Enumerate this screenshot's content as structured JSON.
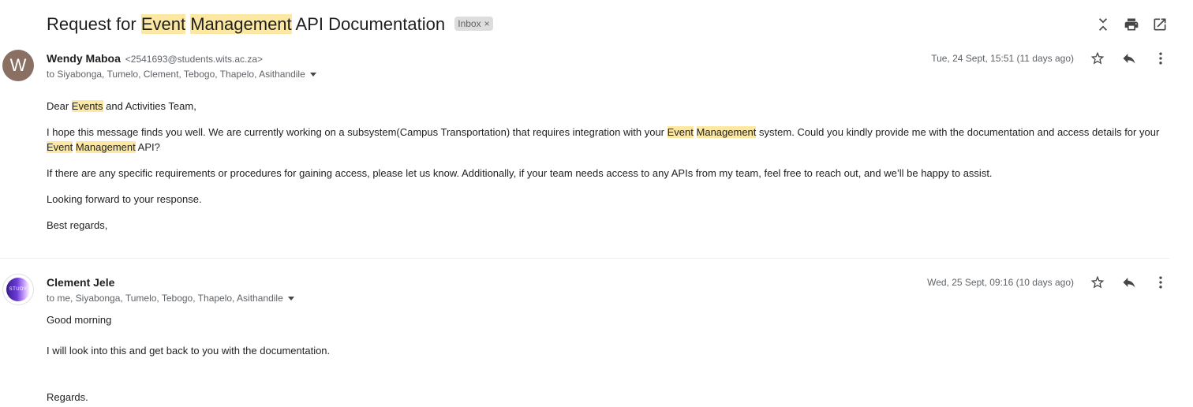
{
  "subject": {
    "parts": [
      "Request for ",
      "Event",
      " ",
      "Management",
      " API Documentation"
    ],
    "label": "Inbox",
    "label_remove": "×"
  },
  "toolbar": {
    "collapse_icon": "collapse-all-icon",
    "print_icon": "print-icon",
    "open_icon": "open-in-new-window-icon"
  },
  "messages": [
    {
      "avatar_letter": "W",
      "sender_name": "Wendy Maboa",
      "sender_email": "<2541693@students.wits.ac.za>",
      "recipients": "to Siyabonga, Tumelo, Clement, Tebogo, Thapelo, Asithandile",
      "date": "Tue, 24 Sept, 15:51 (11 days ago)",
      "greeting_parts": [
        "Dear ",
        "Events",
        " and Activities Team,"
      ],
      "para1_parts": [
        "I hope this message finds you well. We are currently working on a subsystem(Campus Transportation) that requires integration with your ",
        "Event",
        " ",
        "Management",
        " system. Could you kindly provide me with the documentation and access details for your ",
        "Event",
        " ",
        "Management",
        " API?"
      ],
      "para2": "If there are any specific requirements or procedures for gaining access, please let us know. Additionally, if your team needs access to any APIs from my team, feel free to reach out, and we’ll be happy to assist.",
      "para3": "Looking forward to your response.",
      "signoff": "Best regards,"
    },
    {
      "avatar_text": "STUDY",
      "sender_name": "Clement Jele",
      "recipients": "to me, Siyabonga, Tumelo, Tebogo, Thapelo, Asithandile",
      "date": "Wed, 25 Sept, 09:16 (10 days ago)",
      "line1": "Good morning",
      "line2": "I will look into this and get back to you with the documentation.",
      "line3": "Regards."
    }
  ],
  "colors": {
    "highlight": "#fce8a2",
    "avatar_w": "#8a6f63"
  }
}
